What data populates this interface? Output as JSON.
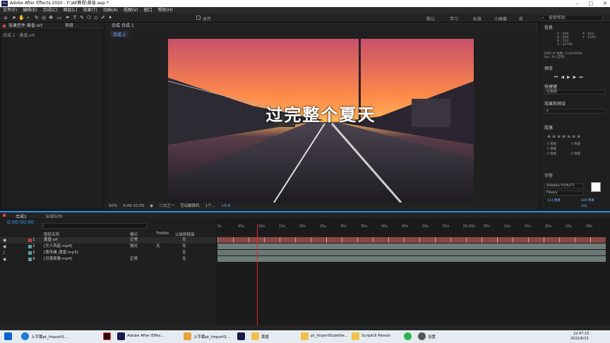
{
  "window": {
    "title": "Adobe After Effects 2020 - F:\\AE教程\\黄昏.aep *",
    "logo": "Ae"
  },
  "menu": [
    "文件(F)",
    "编辑(E)",
    "合成(C)",
    "图层(L)",
    "效果(T)",
    "动画(A)",
    "视图(V)",
    "窗口",
    "帮助(H)"
  ],
  "toolbar": {
    "align_label": "对齐",
    "workspaces": [
      "默认",
      "学习",
      "标准",
      "小屏幕",
      "库"
    ],
    "search_help": "搜索帮助"
  },
  "left_panel": {
    "tab_label": "效果控件 黄昏.srt",
    "tab2_label": "项目",
    "breadcrumb": "合成 1 · 黄昏.srt"
  },
  "comp_panel": {
    "tab_label": "合成 合成 1",
    "subtab_label": "合成 1",
    "caption": "过完整个夏天"
  },
  "viewer_bar": {
    "zoom": "50%",
    "timecode": "0:00:10:05",
    "resolution": "二分之一",
    "camera": "活动摄像机",
    "views": "1个...",
    "exposure": "+0.0"
  },
  "info_panel": {
    "title": "信息",
    "r": "R : 699",
    "g": "G : 690",
    "b": "B : 703",
    "a": "A : 32768",
    "x": "X : 652",
    "y": "Y : 1040",
    "ram": "RAM 中 帧数: 1102/9004",
    "fps": "fps: 30 (实时)"
  },
  "preview_panel": {
    "title": "预览"
  },
  "shortcut_panel": {
    "title": "快捷键",
    "value": "空格键"
  },
  "effects_panel": {
    "title": "效果和预设",
    "search_placeholder": "ρ"
  },
  "paragraph_panel": {
    "title": "段落",
    "indent_values": [
      "0 像素",
      "0 像素",
      "0 像素",
      "0 像素",
      "0 像素"
    ]
  },
  "character_panel": {
    "title": "字符",
    "font": "Alibaba PuHuiTi",
    "weight": "Heavy",
    "size": "123 像素",
    "leading": "109 像素",
    "tracking": "242"
  },
  "timeline": {
    "tabs": [
      "合成1",
      "渲染队列"
    ],
    "timecode": "0:00:00:00",
    "headers": {
      "source": "图层名称",
      "mode": "模式",
      "trkmat": "TrkMat",
      "parent": "父级和链接"
    },
    "ruler": [
      "0s",
      "05s",
      "10s",
      "15s",
      "20s",
      "25s",
      "30s",
      "35s",
      "40s",
      "45s",
      "50s",
      "55s",
      "01:00s",
      "05s",
      "10s",
      "15s",
      "20s",
      "25s",
      "30s"
    ],
    "layers": [
      {
        "num": "1",
        "name": "黄昏.srt",
        "mode": "正常",
        "trkmat": "",
        "parent": "无",
        "color": "#c24141"
      },
      {
        "num": "2",
        "name": "[文人凤起.mp4]",
        "mode": "强光",
        "trkmat": "无",
        "parent": "无",
        "color": "#5fa3a3"
      },
      {
        "num": "3",
        "name": "[周传雄_黄昏.mp3]",
        "mode": "",
        "trkmat": "",
        "parent": "无",
        "color": "#5fa3a3"
      },
      {
        "num": "4",
        "name": "[日落夜晚.mp4]",
        "mode": "正常",
        "trkmat": "",
        "parent": "无",
        "color": "#5fa3a3"
      }
    ]
  },
  "taskbar": {
    "items": [
      "上字幕pt_ImportS...",
      "Adobe After Effec...",
      "上字幕pt_ImportS...",
      "黄昏",
      "pt_ImportSubtitle...",
      "ScriptUI Panels",
      "设置"
    ],
    "time": "22:47:15",
    "date": "2022/8/15"
  },
  "colors": {
    "accent": "#2d8ceb",
    "playhead": "#d62828",
    "srt_bar": "#8b4646",
    "clip_bar": "#6e7e78"
  }
}
